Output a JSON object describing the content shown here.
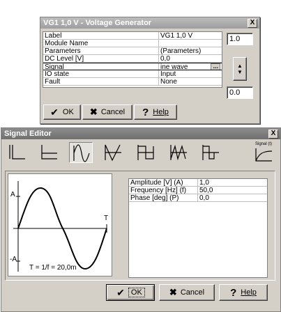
{
  "vg_dialog": {
    "title": "VG1 1,0 V - Voltage Generator",
    "close_label": "X",
    "properties": [
      {
        "name": "Label",
        "value": "VG1 1,0 V"
      },
      {
        "name": "Module Name",
        "value": ""
      },
      {
        "name": "Parameters",
        "value": "(Parameters)"
      },
      {
        "name": "DC Level [V]",
        "value": "0,0"
      },
      {
        "name": "Signal",
        "value": "ine wave",
        "ellipsis": "..."
      },
      {
        "name": "IO state",
        "value": "Input"
      },
      {
        "name": "Fault",
        "value": "None"
      }
    ],
    "top_field_value": "1.0",
    "bottom_field_value": "0.0",
    "buttons": {
      "ok": "OK",
      "cancel": "Cancel",
      "help": "Help"
    }
  },
  "signal_editor": {
    "title": "Signal Editor",
    "close_label": "X",
    "waveforms": [
      "dc-icon",
      "step-icon",
      "sine-icon",
      "triangle-icon",
      "square-icon",
      "sawtooth-icon",
      "pulse-icon",
      "custom-signal-icon"
    ],
    "selected_waveform": "sine-icon",
    "custom_label": "Signal (t)",
    "preview": {
      "a_pos": "A",
      "a_neg": "-A",
      "t_label": "T",
      "period_label": "T = 1/f = 20,0m"
    },
    "parameters": [
      {
        "name": "Amplitude [V] (A)",
        "value": "1,0"
      },
      {
        "name": "Frequency [Hz] (f)",
        "value": "50,0"
      },
      {
        "name": "Phase [deg] (P)",
        "value": "0,0"
      }
    ],
    "buttons": {
      "ok": "OK",
      "cancel": "Cancel",
      "help": "Help"
    }
  }
}
